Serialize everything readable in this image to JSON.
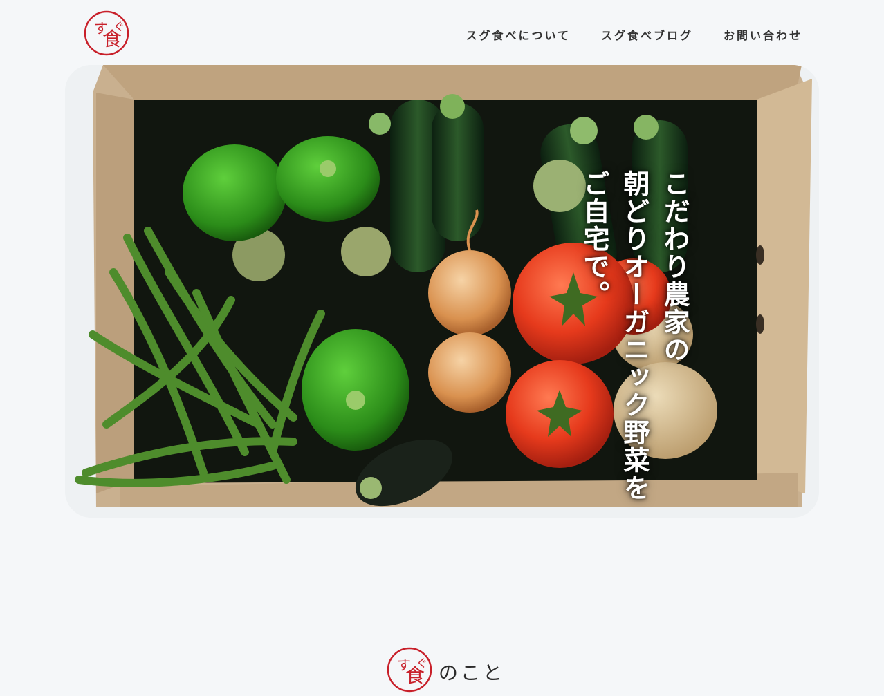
{
  "header": {
    "logo_alt": "すぐ食べ",
    "nav": [
      {
        "label": "スグ食べについて"
      },
      {
        "label": "スグ食べブログ"
      },
      {
        "label": "お問い合わせ"
      }
    ]
  },
  "hero": {
    "headline_lines": [
      "こだわり農家の",
      "朝どりオーガニック野菜を",
      "ご自宅で。"
    ]
  },
  "about": {
    "title": "のこと"
  },
  "colors": {
    "brand_red": "#c8202a",
    "background": "#f5f7f9",
    "text": "#2b2b2b"
  }
}
